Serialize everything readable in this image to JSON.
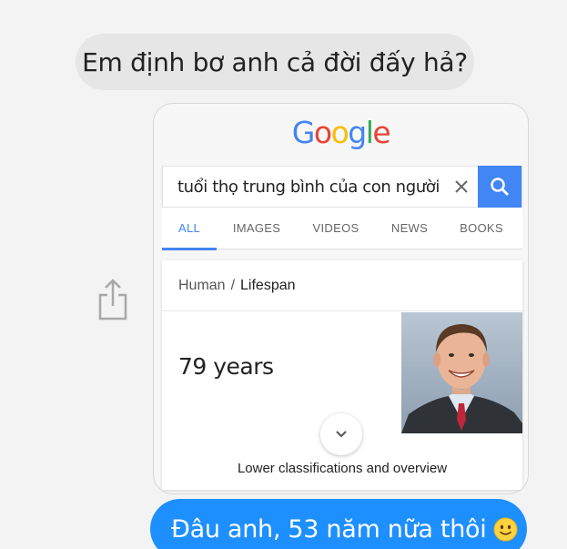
{
  "messages": {
    "incoming": "Em định bơ anh cả đời đấy hả?",
    "outgoing": "Đâu anh, 53 năm nữa thôi",
    "outgoing_emoji": "slightly-smiling-face-emoji"
  },
  "google_card": {
    "logo": {
      "letters": [
        "G",
        "o",
        "o",
        "g",
        "l",
        "e"
      ],
      "colors": [
        "#4285f4",
        "#ea4335",
        "#fbbc05",
        "#4285f4",
        "#34a853",
        "#ea4335"
      ]
    },
    "search": {
      "query": "tuổi thọ trung bình của con người",
      "clear_icon": "close-icon",
      "search_icon": "search-icon"
    },
    "tabs": [
      {
        "label": "ALL",
        "active": true
      },
      {
        "label": "IMAGES",
        "active": false
      },
      {
        "label": "VIDEOS",
        "active": false
      },
      {
        "label": "NEWS",
        "active": false
      },
      {
        "label": "BOOKS",
        "active": false
      }
    ],
    "result": {
      "breadcrumb_first": "Human",
      "breadcrumb_separator": "/",
      "breadcrumb_second": "Lifespan",
      "answer": "79 years",
      "expand_icon": "chevron-down-icon",
      "lower_link": "Lower classifications and overview"
    }
  },
  "share_icon": "share-icon",
  "colors": {
    "accent": "#4285f4",
    "outgoing_bubble": "#1e8fff",
    "incoming_bubble": "#e6e6e6",
    "background": "#f3f3f3"
  }
}
